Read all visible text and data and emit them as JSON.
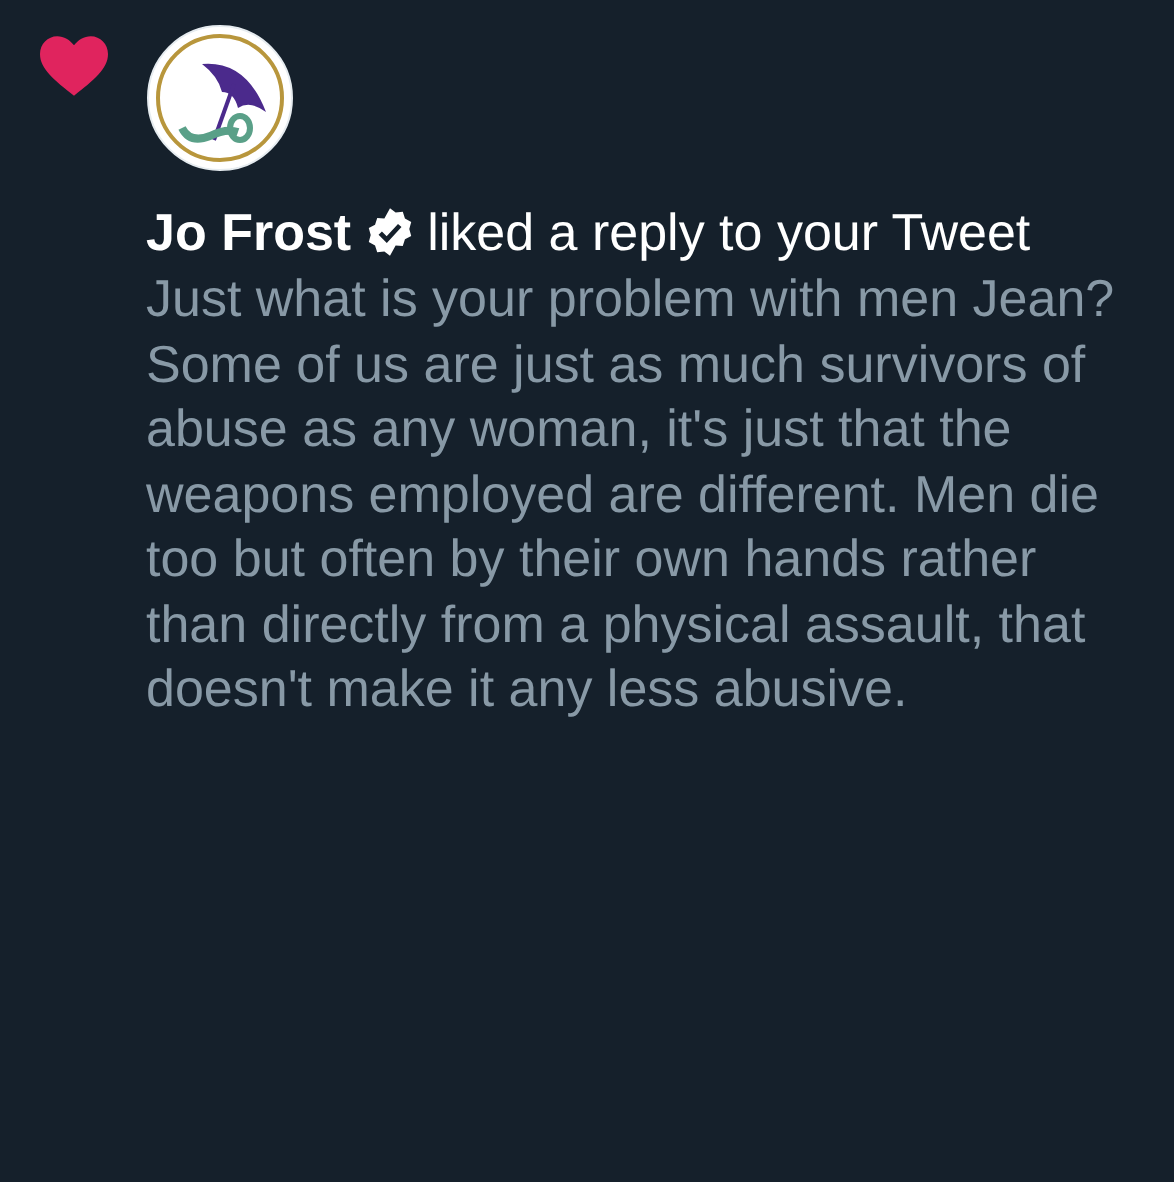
{
  "notification": {
    "kind": "like",
    "user": {
      "name": "Jo Frost",
      "verified": true
    },
    "action": "liked a reply to your Tweet",
    "tweet_text": "Just what is your problem with men Jean?\nSome of us are just as much survivors of abuse as any woman, it's just that the weapons employed are different. Men die too but often by their own hands rather than directly from a physical assault, that doesn't make it any less abusive."
  }
}
